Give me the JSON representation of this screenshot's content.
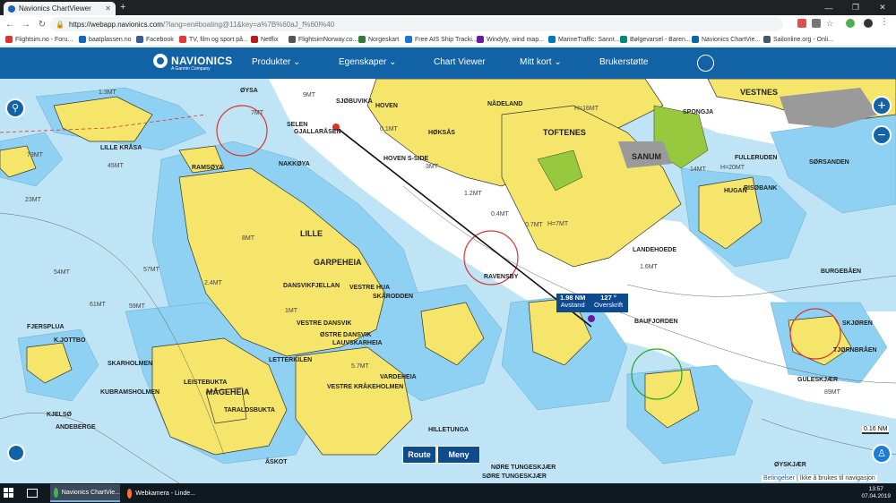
{
  "browser": {
    "tab_title": "Navionics ChartViewer",
    "new_tab": "+",
    "url_main": "https://webapp.navionics.com",
    "url_rest": "/?lang=en#boating@11&key=a%7B%60aJ_f%60l%40",
    "bookmarks": [
      "Flightsim.no - Foru...",
      "baatplassen.no",
      "Facebook",
      "TV, film og sport på...",
      "Netflix",
      "FlightsimNorway.co...",
      "Norgeskart",
      "Free AIS Ship Tracki...",
      "Windyty, wind map...",
      "MarineTraffic: Sannt...",
      "Bølgevarsel - Baren...",
      "Navionics ChartVie...",
      "Sailonline.org - Onli..."
    ]
  },
  "header": {
    "logo": "NAVIONICS",
    "logo_sub": "A Garmin Company",
    "menu": [
      "Produkter",
      "Egenskaper",
      "Chart Viewer",
      "Mitt kort",
      "Brukerstøtte"
    ]
  },
  "map": {
    "place_labels": {
      "lille": "LILLE",
      "garpeheia": "GARPEHEIA",
      "mageheia": "MÅGEHEIA",
      "toftenes": "TOFTENES",
      "sanum": "SANUM",
      "vestnes": "VESTNES",
      "nadeland": "NÅDELAND",
      "hoven": "HOVEN",
      "hoksas": "HØKSÅS",
      "hoven_s": "HOVEN S-SIDE",
      "sjobuvika": "SJØBUVIKA",
      "gjallarasen": "GJALLARÅSEN",
      "nakkoya": "NAKKØYA",
      "ramsoya": "RAMSØYA",
      "lille_krasa": "LILLE KRÅSA",
      "dansvikfjellan": "DANSVIKFJELLAN",
      "vestre_hua": "VESTRE HUA",
      "skarodden": "SKÅRODDEN",
      "vestre_dansvik": "VESTRE DANSVIK",
      "ostre_dansvik": "ØSTRE DANSVIK",
      "lauvskarheia": "LAUVSKARHEIA",
      "letterkilen": "LETTERKILEN",
      "vardeheia": "VARDEHEIA",
      "leistebukta": "LEISTEBUKTA",
      "taraldsbukta": "TARALDSBUKTA",
      "hilletunga": "HILLETUNGA",
      "hugan": "HUGAN",
      "landehoede": "LANDEHOEDE",
      "spongja": "SPONGJA",
      "baufjorden": "BAUFJORDEN",
      "kjottbo": "K.JOTTBO",
      "oysa": "ØYSA",
      "selen": "SELEN",
      "fulleruden": "FULLERUDEN",
      "risobank": "RISØBANK",
      "sorsanden": "SØRSANDEN",
      "burgebaen": "BURGEBÅEN",
      "gulesklor": "GULESKJÆR",
      "oyskjaer": "ØYSKJÆR",
      "tungesk": "SØRE TUNGESKJÆR",
      "tungesk_n": "NØRE TUNGESKJÆR",
      "vestre_kr": "VESTRE KRÅKEHOLMEN",
      "kjelsen": "KJELSØ",
      "fjersplua": "FJERSPLUA",
      "skjoren": "SKJØREN",
      "andvere": "ANDEBERGE",
      "kulefjell": "KUBRAMSHOLMEN",
      "skarholmen": "SKARHOLMEN",
      "tjornbraen": "TJØRNBRÅEN",
      "ravensby": "RAVENSBY",
      "asko": "ÅSKOT"
    },
    "depth_labels": [
      "1.3MT",
      "73MT",
      "45MT",
      "23MT",
      "54MT",
      "61MT",
      "59MT",
      "57MT",
      "2.4MT",
      "1MT",
      "7MT",
      "9MT",
      "0.1MT",
      "5.7MT",
      "8MT",
      "3MT",
      "H=7MT",
      "H=16MT",
      "H=20MT",
      "14MT",
      "1.6MT",
      "1.2MT",
      "0.7MT",
      "0.4MT",
      "89MT"
    ],
    "zoom_in": "+",
    "zoom_out": "−",
    "route_distance_value": "1.98 NM",
    "route_distance_label": "Avstand",
    "route_heading_value": "127 °",
    "route_heading_label": "Overskrift",
    "route_button": "Route",
    "menu_button": "Meny",
    "scale": "0.16 NM",
    "disclaimer_link": "Betingelser",
    "disclaimer_text": "| Ikke å brukes til navigasjon"
  },
  "taskbar": {
    "apps": [
      "Navionics ChartVie...",
      "Webkamera - Linde..."
    ],
    "time": "13:57",
    "date": "07.04.2019"
  },
  "colors": {
    "land": "#f5e56b",
    "shallow": "#8fd1f2",
    "mid": "#bfe4f6",
    "deep": "#ffffff",
    "header": "#1262a6",
    "vegetation": "#96c93d",
    "urban": "#9a9a9a"
  }
}
